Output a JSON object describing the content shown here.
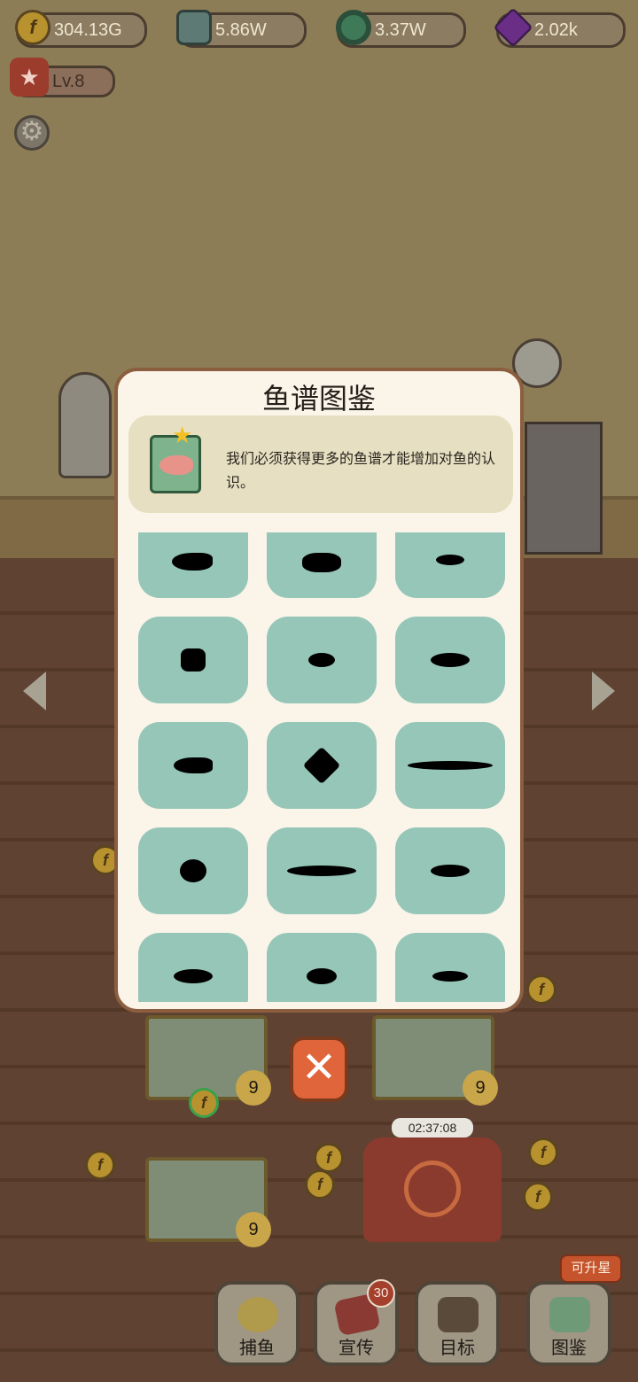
{
  "resources": [
    {
      "icon": "gold-coin-icon",
      "value": "304.13G"
    },
    {
      "icon": "cash-stack-icon",
      "value": "5.86W"
    },
    {
      "icon": "lifebuoy-icon",
      "value": "3.37W"
    },
    {
      "icon": "diamond-icon",
      "value": "2.02k"
    }
  ],
  "level": "Lv.8",
  "modal": {
    "title": "鱼谱图鉴",
    "description": "我们必须获得更多的鱼谱才能增加对鱼的认识。"
  },
  "tanks": [
    {
      "stars": "9"
    },
    {
      "stars": "9"
    },
    {
      "stars": "9"
    }
  ],
  "timer": "02:37:08",
  "nav": {
    "fishing": "捕鱼",
    "promo": "宣传",
    "promo_badge": "30",
    "goals": "目标",
    "encyclopedia": "图鉴",
    "upgrade_tag": "可升星"
  },
  "colors": {
    "tile": "#96c6b8",
    "close_button": "#e0653a",
    "modal_border": "#8b5e3f"
  }
}
